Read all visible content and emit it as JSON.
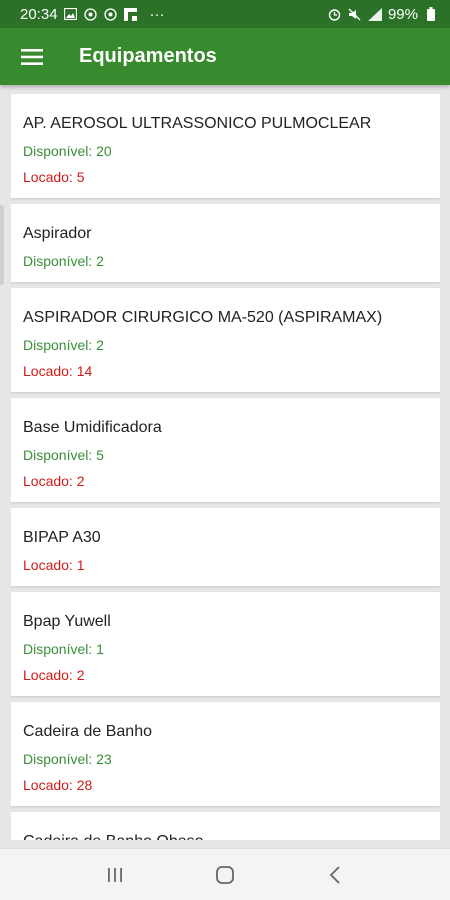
{
  "status_bar": {
    "time": "20:34",
    "battery": "99%",
    "more": "···",
    "left_icons": [
      "image-icon",
      "whatsapp-icon",
      "whatsapp-icon",
      "flipboard-icon"
    ],
    "right_icons": [
      "alarm-icon",
      "mute-icon",
      "signal-icon",
      "battery-icon"
    ]
  },
  "app_bar": {
    "title": "Equipamentos",
    "menu_icon": "hamburger-menu-icon"
  },
  "colors": {
    "primary": "#378b2e",
    "status_bar": "#2b7228",
    "available": "#3a8f3a",
    "rented": "#d11a1a"
  },
  "equipment": [
    {
      "name": "AP. AEROSOL ULTRASSONICO PULMOCLEAR",
      "available": "Disponível: 20",
      "rented": "Locado: 5"
    },
    {
      "name": "Aspirador",
      "available": "Disponível: 2"
    },
    {
      "name": "ASPIRADOR CIRURGICO MA-520 (ASPIRAMAX)",
      "available": "Disponível: 2",
      "rented": "Locado: 14"
    },
    {
      "name": "Base Umidificadora",
      "available": "Disponível: 5",
      "rented": "Locado: 2"
    },
    {
      "name": "BIPAP A30",
      "rented": "Locado: 1"
    },
    {
      "name": "Bpap Yuwell",
      "available": "Disponível: 1",
      "rented": "Locado: 2"
    },
    {
      "name": "Cadeira de Banho",
      "available": "Disponível: 23",
      "rented": "Locado: 28"
    },
    {
      "name": "Cadeira de Banho Obeso"
    }
  ],
  "nav_bar": {
    "icons": [
      "recent-apps-icon",
      "home-icon",
      "back-icon"
    ]
  }
}
